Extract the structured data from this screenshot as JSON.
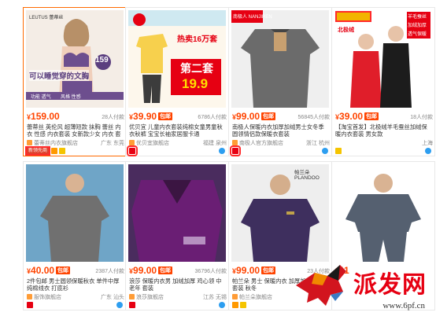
{
  "cards": [
    {
      "price": "159.00",
      "sold": "28人付款",
      "title_kw": "",
      "title": "蕾蒂丝 英伦风 超薄短款 抹胸 蕾丝 内衣 性感 内衣套装 女新款少女 内衣 套装 99301",
      "shop": "蕾蒂丝内衣旗舰店",
      "location": "广东 东莞",
      "img_brand": "LEUTUS 蕾蒂丝",
      "img_price": "159",
      "img_slogan": "可以睡觉穿的文胸",
      "img_strip_a": "功能 透气",
      "img_strip_b": "风格 性感",
      "tag": "新领先商"
    },
    {
      "price": "39.90",
      "sold": "6786人付款",
      "title_kw": "内衣",
      "title": "优贝宜 儿童内衣套装纯棉女童男童秋衣秋裤 宝宝长袖家居服卡通",
      "shop": "优贝宜旗舰店",
      "location": "福建 泉州",
      "img_line1": "热卖16万套",
      "img_line2": "第二套",
      "img_price": "19.9"
    },
    {
      "price": "99.00",
      "sold": "56845人付款",
      "title_kw": "内衣",
      "title": "南极人保暖内衣加厚加绒男士女冬季圆领情侣款保暖衣套装",
      "shop": "南极人官方旗舰店",
      "location": "浙江 杭州",
      "img_brand": "南极人 NANJIREN"
    },
    {
      "price": "39.00",
      "sold": "18人付款",
      "title_kw": "",
      "title": "【淘宝首发】北极绒羊毛蚕丝加绒保暖内衣套装 男女款",
      "shop": "",
      "location": "上海",
      "img_brand": "北极绒",
      "img_tags": [
        "羊毛蚕丝",
        "加绒加厚",
        "透气保暖"
      ]
    },
    {
      "price": "40.00",
      "sold": "2387人付款",
      "title_kw": "",
      "title": "2件包邮 男士圆领保暖秋衣 单件中厚纯棉线衣 打底衫",
      "shop": "服饰旗舰店",
      "location": "广东 汕头"
    },
    {
      "price": "99.00",
      "sold": "36796人付款",
      "title_kw": "内衣",
      "title": "浪莎 保暖内衣男 加绒加厚 鸡心领 中老年 套装",
      "shop": "浪莎旗舰店",
      "location": "江苏 无锡"
    },
    {
      "price": "99.00",
      "sold": "23人付款",
      "title_kw": "内衣",
      "title": "帕兰朵 男士 保暖内衣 加厚加绒 圆领 套装 秋冬",
      "shop": "帕兰朵旗舰店",
      "location": "浙江",
      "img_brand": "帕兰朵 PLANDOO"
    },
    {
      "price": "11",
      "sold": "",
      "title_kw": "",
      "title": "",
      "shop": "",
      "location": ""
    }
  ],
  "watermark": {
    "text": "派发网",
    "url": "www.6pf.cn"
  },
  "colors": {
    "price": "#ff4400",
    "accent": "#e60012",
    "border_hl": "#ff6a00"
  }
}
